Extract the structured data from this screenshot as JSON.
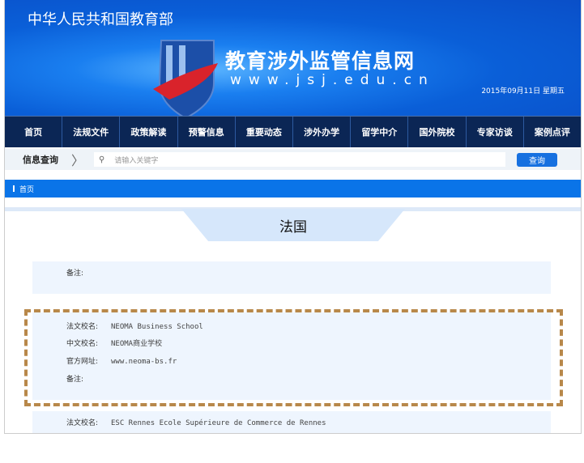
{
  "header": {
    "ministry": "中华人民共和国教育部",
    "site_title": "教育涉外监管信息网",
    "site_url": "www.jsj.edu.cn",
    "date": "2015年09月11日  星期五"
  },
  "nav": [
    "首页",
    "法规文件",
    "政策解读",
    "预警信息",
    "重要动态",
    "涉外办学",
    "留学中介",
    "国外院校",
    "专家访谈",
    "案例点评"
  ],
  "search": {
    "label": "信息查询",
    "placeholder": "请输入关键字",
    "button": "查询"
  },
  "breadcrumb": "首页",
  "country": "法国",
  "entries": [
    {
      "remark_label": "备注:"
    },
    {
      "fr_label": "法文校名:",
      "fr_name": "NEOMA Business School",
      "cn_label": "中文校名:",
      "cn_name": "NEOMA商业学校",
      "url_label": "官方网址:",
      "url": "www.neoma-bs.fr",
      "remark_label": "备注:"
    },
    {
      "fr_label": "法文校名:",
      "fr_name": "ESC Rennes Ecole Supérieure de Commerce de Rennes"
    }
  ],
  "colors": {
    "header": "#0a5fd8",
    "nav": "#0b2655",
    "accent": "#0a74e8",
    "highlight": "#b8884a"
  }
}
